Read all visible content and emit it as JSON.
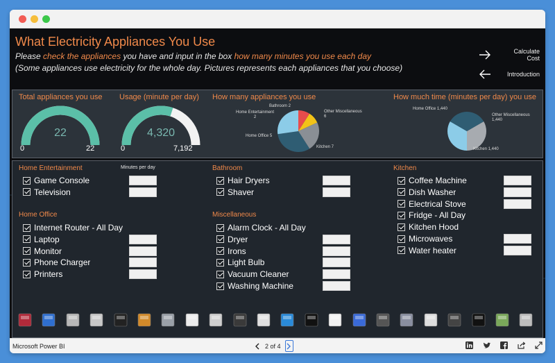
{
  "report": {
    "title": "What Electricity Appliances You Use",
    "line1_a": "Please ",
    "line1_b": "check the appliances",
    "line1_c": " you have and input in the box ",
    "line1_d": "how many minutes you use each day",
    "line2": "(Some appliances use electricity for the whole day. Pictures represents each appliances that you choose)",
    "nav": {
      "calculate": "Calculate Cost",
      "introduction": "Introduction"
    }
  },
  "kpis": {
    "total": {
      "title": "Total appliances you use",
      "value": "22",
      "min": "0",
      "max": "22",
      "fill_fraction": 1.0
    },
    "usage": {
      "title": "Usage (minute per day)",
      "value": "4,320",
      "min": "0",
      "max": "7,192",
      "fill_fraction": 0.6
    }
  },
  "chart_data": [
    {
      "type": "pie",
      "title": "How many appliances you use",
      "categories": [
        "Bathroom",
        "Home Entertainment",
        "Home Office",
        "Kitchen",
        "Other Miscellaneous"
      ],
      "values": [
        2,
        2,
        5,
        7,
        6
      ],
      "labels": [
        "Bathroom 2",
        "Home Entertainment\n2",
        "Home Office 5",
        "Kitchen 7",
        "Other Miscellaneous\n6"
      ],
      "colors": [
        "#e84c4c",
        "#f2c318",
        "#8a8f95",
        "#2f5d73",
        "#8ccce8"
      ]
    },
    {
      "type": "pie",
      "title": "How much time (minutes per day) you use",
      "categories": [
        "Home Office",
        "Other Miscellaneous",
        "Kitchen"
      ],
      "values": [
        1440,
        1440,
        1440
      ],
      "labels": [
        "Home Office 1,440",
        "Other Miscellaneous\n1,440",
        "Kitchen 1,440"
      ],
      "colors": [
        "#a7abb0",
        "#8ccce8",
        "#2f5d73"
      ]
    }
  ],
  "sections": {
    "minutes_header": "Minutes per day",
    "home_entertainment": {
      "title": "Home Entertainment",
      "items": [
        "Game Console",
        "Television"
      ]
    },
    "home_office": {
      "title": "Home Office",
      "items": [
        "Internet Router - All Day",
        "Laptop",
        "Monitor",
        "Phone Charger",
        "Printers"
      ]
    },
    "bathroom": {
      "title": "Bathroom",
      "items": [
        "Hair Dryers",
        "Shaver"
      ]
    },
    "miscellaneous": {
      "title": "Miscellaneous",
      "items": [
        "Alarm Clock - All Day",
        "Dryer",
        "Irons",
        "Light Bulb",
        "Vacuum Cleaner",
        "Washing Machine"
      ]
    },
    "kitchen": {
      "title": "Kitchen",
      "items": [
        "Coffee Machine",
        "Dish Washer",
        "Electrical Stove",
        "Fridge - All Day",
        "Kitchen Hood",
        "Microwaves",
        "Water heater"
      ]
    }
  },
  "thumbnails": [
    "printer-icon",
    "laptop-icon",
    "washing-machine-icon",
    "dishwasher-icon",
    "hair-dryer-icon",
    "light-bulb-icon",
    "iron-icon",
    "shaver-icon",
    "microwave-icon",
    "stove-icon",
    "oven-icon",
    "television-icon",
    "router-icon",
    "washer-icon",
    "vacuum-icon",
    "coffee-machine-icon",
    "laptop-2-icon",
    "fridge-icon",
    "shaver-2-icon",
    "alarm-clock-icon",
    "monitor-icon",
    "kitchen-hood-icon"
  ],
  "colors": {
    "accent": "#f0894a",
    "gauge_fill": "#5bbfa8",
    "gauge_track": "#f2f2f2",
    "background": "#0c0d10"
  },
  "status_bar": {
    "brand": "Microsoft Power BI",
    "page": "2 of 4",
    "icons": [
      "linkedin-icon",
      "twitter-icon",
      "facebook-icon",
      "share-icon",
      "expand-icon"
    ]
  }
}
